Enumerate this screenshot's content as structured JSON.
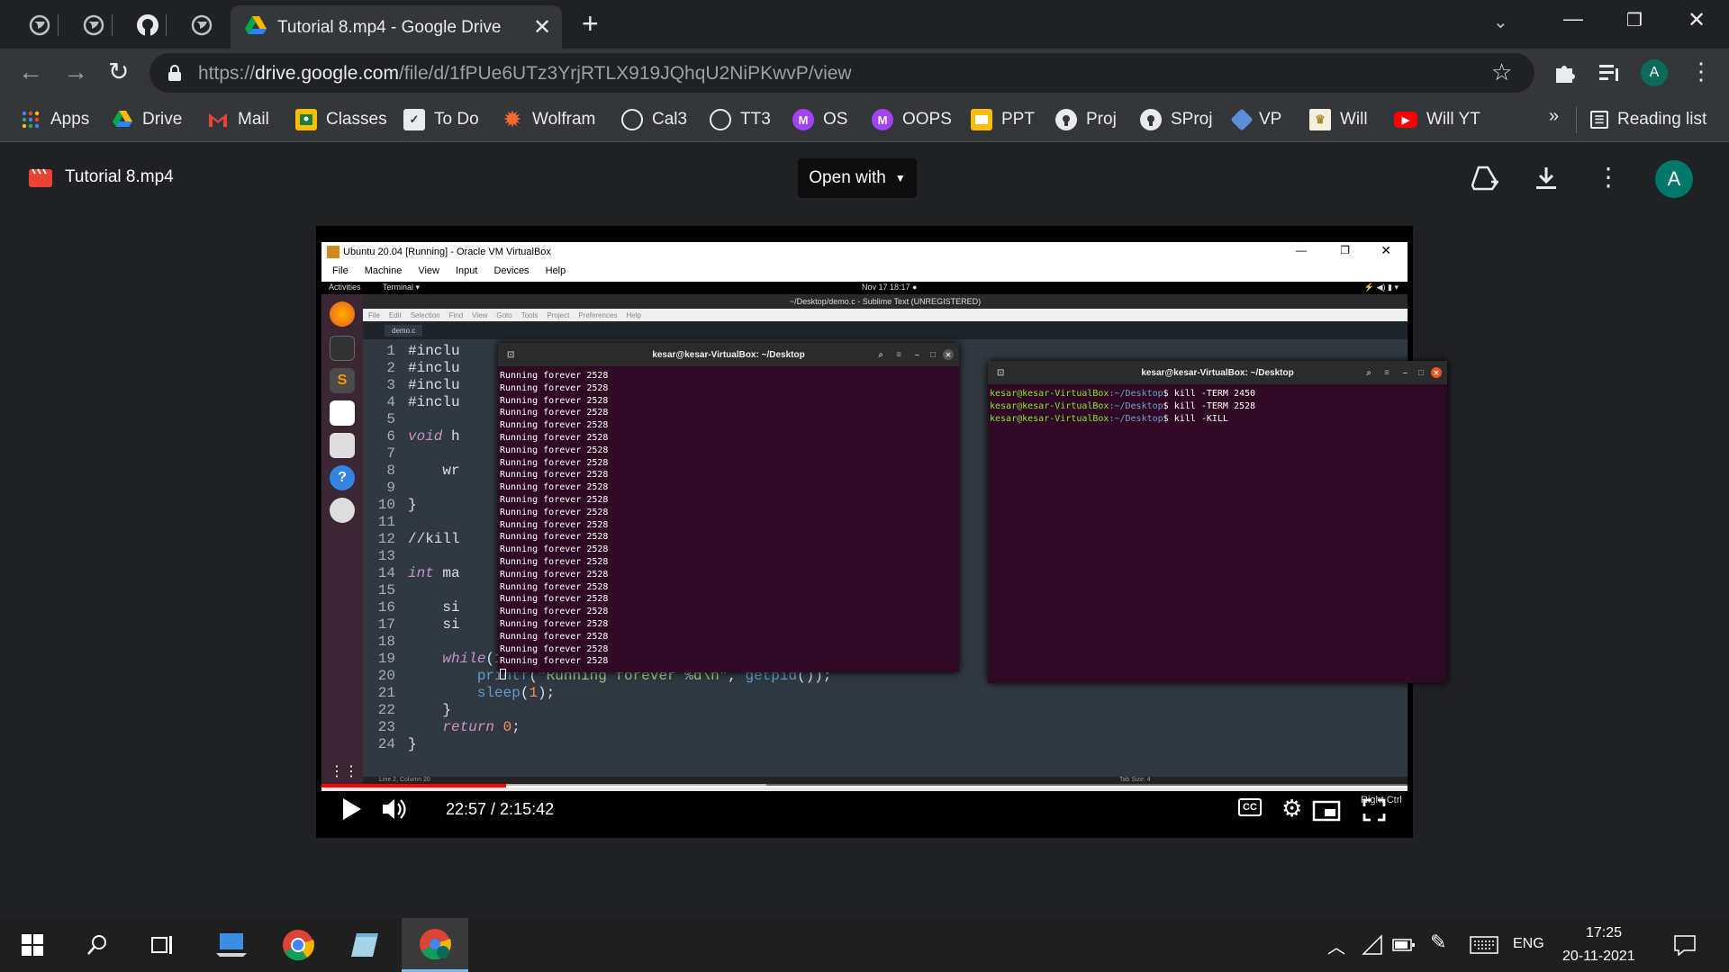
{
  "browser": {
    "tab_title": "Tutorial 8.mp4 - Google Drive",
    "url_prefix": "https://",
    "url_host": "drive.google.com",
    "url_path": "/file/d/1fPUe6UTz3YrjRTLX919JQhqU2NiPKwvP/view",
    "profile_initial": "A"
  },
  "bookmarks": [
    {
      "label": "Apps",
      "icon": "apps-grid-icon"
    },
    {
      "label": "Drive",
      "icon": "drive-icon"
    },
    {
      "label": "Mail",
      "icon": "gmail-icon"
    },
    {
      "label": "Classes",
      "icon": "classroom-icon"
    },
    {
      "label": "To Do",
      "icon": "todo-icon"
    },
    {
      "label": "Wolfram",
      "icon": "wolfram-icon"
    },
    {
      "label": "Cal3",
      "icon": "globe-icon"
    },
    {
      "label": "TT3",
      "icon": "globe-icon"
    },
    {
      "label": "OS",
      "icon": "m-letter-icon"
    },
    {
      "label": "OOPS",
      "icon": "m-letter-icon"
    },
    {
      "label": "PPT",
      "icon": "slides-icon"
    },
    {
      "label": "Proj",
      "icon": "github-icon"
    },
    {
      "label": "SProj",
      "icon": "github-icon"
    },
    {
      "label": "VP",
      "icon": "vp-icon"
    },
    {
      "label": "Will",
      "icon": "will-icon"
    },
    {
      "label": "Will YT",
      "icon": "youtube-icon"
    }
  ],
  "reading_list": "Reading list",
  "drive": {
    "file_name": "Tutorial 8.mp4",
    "open_with": "Open with",
    "avatar": "A"
  },
  "vm": {
    "title": "Ubuntu 20.04 [Running] - Oracle VM VirtualBox",
    "menu": [
      "File",
      "Machine",
      "View",
      "Input",
      "Devices",
      "Help"
    ],
    "activities": "Activities",
    "app": "Terminal ▾",
    "clock": "Nov 17  18:17  ●",
    "sublime_title": "~/Desktop/demo.c - Sublime Text (UNREGISTERED)",
    "sublime_menu": [
      "File",
      "Edit",
      "Selection",
      "Find",
      "View",
      "Goto",
      "Tools",
      "Project",
      "Preferences",
      "Help"
    ],
    "sublime_tab": "demo.c",
    "status_left": "Line 2, Column 20",
    "status_right": "Tab Size: 4",
    "host_key": "Right Ctrl"
  },
  "code_lines": [
    {
      "n": "1",
      "t": "#inclu"
    },
    {
      "n": "2",
      "t": "#inclu"
    },
    {
      "n": "3",
      "t": "#inclu"
    },
    {
      "n": "4",
      "t": "#inclu"
    },
    {
      "n": "5",
      "t": ""
    },
    {
      "n": "6",
      "t": "void h"
    },
    {
      "n": "7",
      "t": ""
    },
    {
      "n": "8",
      "t": "    wr"
    },
    {
      "n": "9",
      "t": ""
    },
    {
      "n": "10",
      "t": "}"
    },
    {
      "n": "11",
      "t": ""
    },
    {
      "n": "12",
      "t": "//kill"
    },
    {
      "n": "13",
      "t": ""
    },
    {
      "n": "14",
      "t": "int ma"
    },
    {
      "n": "15",
      "t": ""
    },
    {
      "n": "16",
      "t": "    si"
    },
    {
      "n": "17",
      "t": "    si"
    },
    {
      "n": "18",
      "t": ""
    },
    {
      "n": "19",
      "t": "    while(1){"
    },
    {
      "n": "20",
      "t": "        printf(\"Running forever %d\\n\", getpid());"
    },
    {
      "n": "21",
      "t": "        sleep(1);"
    },
    {
      "n": "22",
      "t": "    }"
    },
    {
      "n": "23",
      "t": "    return 0;"
    },
    {
      "n": "24",
      "t": "}"
    }
  ],
  "term1": {
    "title": "kesar@kesar-VirtualBox: ~/Desktop",
    "line": "Running forever 2528",
    "count": 24
  },
  "term2": {
    "title": "kesar@kesar-VirtualBox: ~/Desktop",
    "prompt_user": "kesar@kesar-VirtualBox",
    "prompt_path": ":~/Desktop",
    "commands": [
      "$ kill -TERM 2450",
      "$ kill -TERM 2528",
      "$ kill -KILL"
    ]
  },
  "player": {
    "time": "22:57 / 2:15:42",
    "progress_fraction": 0.17,
    "buffered_fraction": 0.41
  },
  "taskbar": {
    "lang": "ENG",
    "time": "17:25",
    "date": "20-11-2021"
  },
  "colors": {
    "accent_red": "#ff0000",
    "drive_avatar": "#00796b",
    "terminal_bg": "#300a24"
  }
}
